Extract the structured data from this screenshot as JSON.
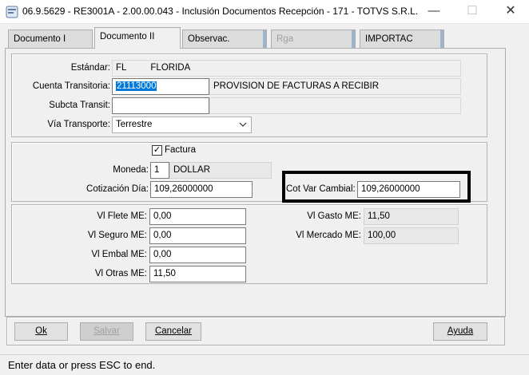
{
  "window": {
    "title": "06.9.5629 - RE3001A - 2.00.00.043 - Inclusión Documentos Recepción - 171 - TOTVS S.R.L.",
    "minimize_glyph": "—",
    "maximize_glyph": "☐",
    "close_glyph": "✕"
  },
  "tabs": [
    {
      "label": "Documento  I"
    },
    {
      "label": "Documento II"
    },
    {
      "label": "Observac."
    },
    {
      "label": "Rga"
    },
    {
      "label": "IMPORTAC"
    }
  ],
  "general": {
    "estandar_label": "Estándar:",
    "estandar_code": "FL",
    "estandar_desc": "FLORIDA",
    "cuenta_label": "Cuenta Transitoria:",
    "cuenta_value": "21113000",
    "cuenta_desc": "PROVISION DE FACTURAS A  RECIBIR",
    "subcta_label": "Subcta Transit:",
    "subcta_value": "",
    "via_label": "Vía Transporte:",
    "via_value": "Terrestre"
  },
  "moneda": {
    "factura_label": "Factura",
    "factura_checked": true,
    "moneda_label": "Moneda:",
    "moneda_code": "1",
    "moneda_desc": "DOLLAR",
    "cotizacion_label": "Cotización Día:",
    "cotizacion_value": "109,26000000",
    "cotvar_label": "Cot Var Cambial:",
    "cotvar_value": "109,26000000"
  },
  "valores": {
    "flete_label": "Vl Flete ME:",
    "flete_value": "0,00",
    "seguro_label": "Vl Seguro ME:",
    "seguro_value": "0,00",
    "embal_label": "Vl Embal ME:",
    "embal_value": "0,00",
    "otras_label": "Vl Otras ME:",
    "otras_value": "11,50",
    "gasto_label": "Vl Gasto ME:",
    "gasto_value": "11,50",
    "mercado_label": "Vl Mercado ME:",
    "mercado_value": "100,00"
  },
  "buttons": {
    "ok": "Ok",
    "salvar": "Salvar",
    "cancelar": "Cancelar",
    "ayuda": "Ayuda"
  },
  "status": "Enter data or press ESC to end."
}
